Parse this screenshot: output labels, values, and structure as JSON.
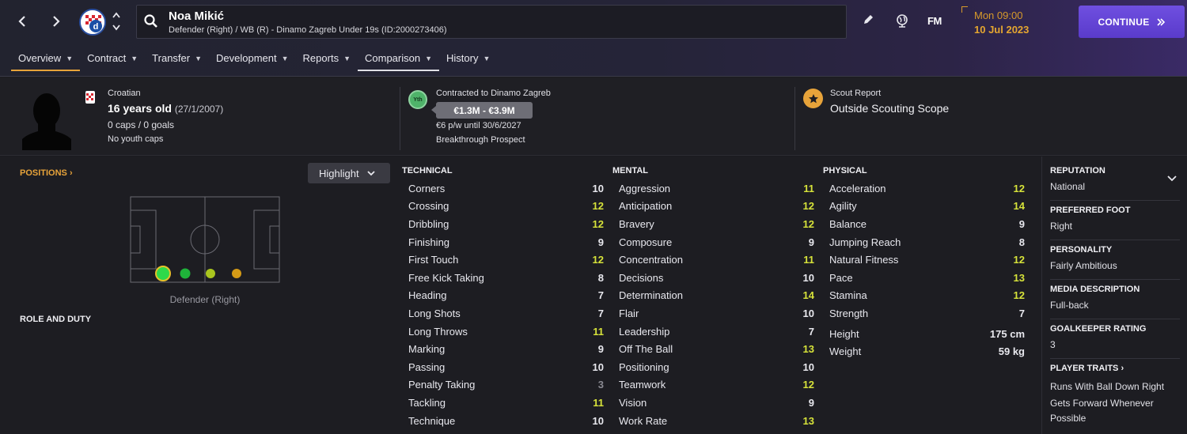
{
  "header": {
    "player_name": "Noa Mikić",
    "subtitle": "Defender (Right) / WB (R) - Dinamo Zagreb Under 19s (ID:2000273406)",
    "fm_logo": "FM",
    "date_time": "Mon 09:00",
    "date_day": "10 Jul 2023",
    "continue_label": "CONTINUE",
    "icons": [
      "back-arrow-icon",
      "forward-arrow-icon",
      "club-badge-icon",
      "search-icon",
      "pencil-icon",
      "globe-icon",
      "chevron-double-right-icon"
    ]
  },
  "tabs": [
    {
      "label": "Overview"
    },
    {
      "label": "Contract"
    },
    {
      "label": "Transfer"
    },
    {
      "label": "Development"
    },
    {
      "label": "Reports"
    },
    {
      "label": "Comparison"
    },
    {
      "label": "History"
    }
  ],
  "info": {
    "nationality": "Croatian",
    "age": "16 years old",
    "dob": "(27/1/2007)",
    "caps": "0 caps / 0 goals",
    "youth_caps": "No youth caps",
    "yth_badge": "Yth",
    "contract_label": "Contracted to Dinamo Zagreb",
    "value": "€1.3M - €3.9M",
    "wage": "€6 p/w until 30/6/2027",
    "prospect": "Breakthrough Prospect",
    "scout_label": "Scout Report",
    "scout_value": "Outside Scouting Scope"
  },
  "positions": {
    "title": "POSITIONS",
    "highlight_label": "Highlight",
    "position_label": "Defender (Right)",
    "role_title": "ROLE AND DUTY"
  },
  "attributes": {
    "technical": {
      "title": "TECHNICAL",
      "rows": [
        {
          "name": "Corners",
          "value": "10"
        },
        {
          "name": "Crossing",
          "value": "12"
        },
        {
          "name": "Dribbling",
          "value": "12"
        },
        {
          "name": "Finishing",
          "value": "9"
        },
        {
          "name": "First Touch",
          "value": "12"
        },
        {
          "name": "Free Kick Taking",
          "value": "8"
        },
        {
          "name": "Heading",
          "value": "7"
        },
        {
          "name": "Long Shots",
          "value": "7"
        },
        {
          "name": "Long Throws",
          "value": "11"
        },
        {
          "name": "Marking",
          "value": "9"
        },
        {
          "name": "Passing",
          "value": "10"
        },
        {
          "name": "Penalty Taking",
          "value": "3"
        },
        {
          "name": "Tackling",
          "value": "11"
        },
        {
          "name": "Technique",
          "value": "10"
        }
      ]
    },
    "mental": {
      "title": "MENTAL",
      "rows": [
        {
          "name": "Aggression",
          "value": "11"
        },
        {
          "name": "Anticipation",
          "value": "12"
        },
        {
          "name": "Bravery",
          "value": "12"
        },
        {
          "name": "Composure",
          "value": "9"
        },
        {
          "name": "Concentration",
          "value": "11"
        },
        {
          "name": "Decisions",
          "value": "10"
        },
        {
          "name": "Determination",
          "value": "14"
        },
        {
          "name": "Flair",
          "value": "10"
        },
        {
          "name": "Leadership",
          "value": "7"
        },
        {
          "name": "Off The Ball",
          "value": "13"
        },
        {
          "name": "Positioning",
          "value": "10"
        },
        {
          "name": "Teamwork",
          "value": "12"
        },
        {
          "name": "Vision",
          "value": "9"
        },
        {
          "name": "Work Rate",
          "value": "13"
        }
      ]
    },
    "physical": {
      "title": "PHYSICAL",
      "rows": [
        {
          "name": "Acceleration",
          "value": "12"
        },
        {
          "name": "Agility",
          "value": "14"
        },
        {
          "name": "Balance",
          "value": "9"
        },
        {
          "name": "Jumping Reach",
          "value": "8"
        },
        {
          "name": "Natural Fitness",
          "value": "12"
        },
        {
          "name": "Pace",
          "value": "13"
        },
        {
          "name": "Stamina",
          "value": "12"
        },
        {
          "name": "Strength",
          "value": "7"
        }
      ],
      "height_label": "Height",
      "height_value": "175 cm",
      "weight_label": "Weight",
      "weight_value": "59 kg"
    }
  },
  "side_panel": {
    "reputation_label": "REPUTATION",
    "reputation_value": "National",
    "foot_label": "PREFERRED FOOT",
    "foot_value": "Right",
    "personality_label": "PERSONALITY",
    "personality_value": "Fairly Ambitious",
    "media_label": "MEDIA DESCRIPTION",
    "media_value": "Full-back",
    "gk_label": "GOALKEEPER RATING",
    "gk_value": "3",
    "traits_label": "PLAYER TRAITS",
    "traits": [
      "Runs With Ball Down Right",
      "Gets Forward Whenever Possible"
    ]
  },
  "colors": {
    "accent": "#e7a33a",
    "continue": "#5a3bcb",
    "attr_high": "#d6e23a",
    "attr_low": "#8a8a92"
  }
}
